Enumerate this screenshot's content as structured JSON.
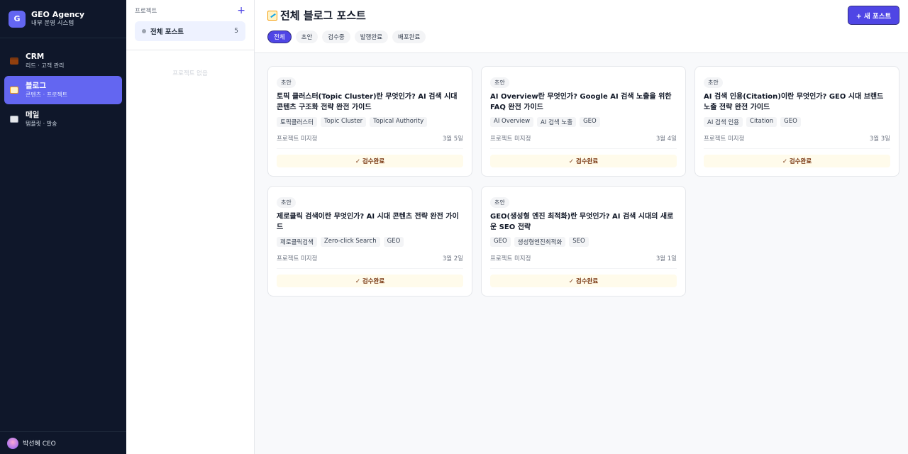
{
  "brand": {
    "logo": "G",
    "name": "GEO Agency",
    "subtitle": "내부 운영 시스템"
  },
  "nav": [
    {
      "title": "CRM",
      "subtitle": "리드 · 고객 관리",
      "icon": "briefcase-icon"
    },
    {
      "title": "블로그",
      "subtitle": "콘텐츠 · 프로젝트",
      "icon": "memo-icon",
      "active": true
    },
    {
      "title": "메일",
      "subtitle": "템플릿 · 발송",
      "icon": "envelope-icon"
    }
  ],
  "user": {
    "name": "박선혜 CEO"
  },
  "projects": {
    "header": "프로젝트",
    "add": "+",
    "all_label": "전체 포스트",
    "all_count": "5",
    "empty": "프로젝트 없음"
  },
  "main": {
    "title": "전체 블로그 포스트",
    "new_button": "+ 새 포스트",
    "tabs": [
      "전체",
      "초안",
      "검수중",
      "발행완료",
      "배포완료"
    ],
    "active_tab": "전체"
  },
  "posts": [
    {
      "badge": "초안",
      "title": "토픽 클러스터(Topic Cluster)란 무엇인가? AI 검색 시대 콘텐츠 구조화 전략 완전 가이드",
      "tags": [
        "토픽클러스터",
        "Topic Cluster",
        "Topical Authority"
      ],
      "project": "프로젝트 미지정",
      "date": "3월 5일",
      "status": "✓ 검수완료"
    },
    {
      "badge": "초안",
      "title": "AI Overview란 무엇인가? Google AI 검색 노출을 위한 FAQ 완전 가이드",
      "tags": [
        "AI Overview",
        "AI 검색 노출",
        "GEO"
      ],
      "project": "프로젝트 미지정",
      "date": "3월 4일",
      "status": "✓ 검수완료"
    },
    {
      "badge": "초안",
      "title": "AI 검색 인용(Citation)이란 무엇인가? GEO 시대 브랜드 노출 전략 완전 가이드",
      "tags": [
        "AI 검색 인용",
        "Citation",
        "GEO"
      ],
      "project": "프로젝트 미지정",
      "date": "3월 3일",
      "status": "✓ 검수완료"
    },
    {
      "badge": "초안",
      "title": "제로클릭 검색이란 무엇인가? AI 시대 콘텐츠 전략 완전 가이드",
      "tags": [
        "제로클릭검색",
        "Zero-click Search",
        "GEO"
      ],
      "project": "프로젝트 미지정",
      "date": "3월 2일",
      "status": "✓ 검수완료"
    },
    {
      "badge": "초안",
      "title": "GEO(생성형 엔진 최적화)란 무엇인가? AI 검색 시대의 새로운 SEO 전략",
      "tags": [
        "GEO",
        "생성형엔진최적화",
        "SEO"
      ],
      "project": "프로젝트 미지정",
      "date": "3월 1일",
      "status": "✓ 검수완료"
    }
  ],
  "colors": {
    "accent": "#4f46e5",
    "sidebar": "#0f172a",
    "status_bg": "#fffbeb"
  }
}
